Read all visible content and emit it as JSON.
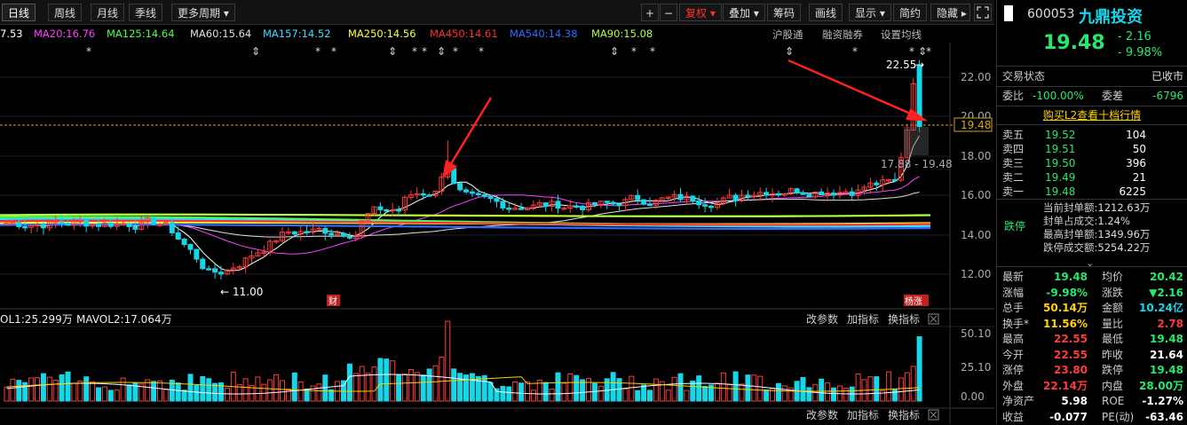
{
  "toolbar": {
    "tabs": [
      "日线",
      "周线",
      "月线",
      "季线",
      "更多周期 ▾"
    ],
    "right_buttons": [
      "+",
      "−",
      "复权 ▾",
      "叠加 ▾",
      "筹码",
      "画线",
      "显示 ▾",
      "简约",
      "隐藏 ▸"
    ],
    "expand_icon": "expand-icon"
  },
  "ma_legend": [
    {
      "text": "7.53",
      "color": "#ffffff"
    },
    {
      "text": "MA20:16.76",
      "color": "#ff40ff"
    },
    {
      "text": "MA125:14.64",
      "color": "#4cff4c"
    },
    {
      "text": "MA60:15.64",
      "color": "#e0e0e0"
    },
    {
      "text": "MA157:14.52",
      "color": "#33e0ff"
    },
    {
      "text": "MA250:14.56",
      "color": "#ffff40"
    },
    {
      "text": "MA450:14.61",
      "color": "#ff3030"
    },
    {
      "text": "MA540:14.38",
      "color": "#2f6bff"
    },
    {
      "text": "MA90:15.08",
      "color": "#b9ff3f"
    }
  ],
  "ma_links": [
    "沪股通",
    "融资融券",
    "设置均线"
  ],
  "price_axis": [
    "22.00",
    "20.00",
    "18.00",
    "16.00",
    "14.00",
    "12.00"
  ],
  "current_price_tag": "19.48",
  "annotations": {
    "high": "22.55",
    "low": "11.00",
    "range": "17.88 - 19.48",
    "badge_cai": "财",
    "badge_zt": "杨涨"
  },
  "volume_legend": {
    "vol1": "OL1:25.299万",
    "mavol2": "MAVOL2:17.064万",
    "buttons": [
      "改参数",
      "加指标",
      "换指标"
    ]
  },
  "volume_axis": [
    "50.10",
    "25.10",
    "0.00"
  ],
  "bottom_buttons": [
    "改参数",
    "加指标",
    "换指标"
  ],
  "stock": {
    "code": "600053",
    "name": "九鼎投资",
    "price": "19.48",
    "change": "- 2.16",
    "change_pct": "- 9.98%"
  },
  "status": {
    "label": "交易状态",
    "value": "已收市"
  },
  "weibi": {
    "label1": "委比",
    "value1": "-100.00%",
    "label2": "委差",
    "value2": "-6796"
  },
  "l2_link": "购买L2查看十档行情",
  "asks": [
    {
      "label": "卖五",
      "price": "19.52",
      "vol": "104"
    },
    {
      "label": "卖四",
      "price": "19.51",
      "vol": "50"
    },
    {
      "label": "卖三",
      "price": "19.50",
      "vol": "396"
    },
    {
      "label": "卖二",
      "price": "19.49",
      "vol": "21"
    },
    {
      "label": "卖一",
      "price": "19.48",
      "vol": "6225"
    }
  ],
  "limit_info": {
    "tag": "跌停",
    "lines": [
      {
        "label": "当前封单额:",
        "value": "1212.63万"
      },
      {
        "label": "封单占成交:",
        "value": "1.24%"
      },
      {
        "label": "最高封单额:",
        "value": "1349.96万"
      },
      {
        "label": "跌停成交额:",
        "value": "5254.22万"
      }
    ]
  },
  "quotes": [
    {
      "l1": "最新",
      "v1": "19.48",
      "c1": "green",
      "l2": "均价",
      "v2": "20.42",
      "c2": "green"
    },
    {
      "l1": "涨幅",
      "v1": "-9.98%",
      "c1": "green",
      "l2": "涨跌",
      "v2": "▼2.16",
      "c2": "green"
    },
    {
      "l1": "总手",
      "v1": "50.14万",
      "c1": "yellow",
      "l2": "金额",
      "v2": "10.24亿",
      "c2": "cyan"
    },
    {
      "l1": "换手*",
      "v1": "11.56%",
      "c1": "yellow",
      "l2": "量比",
      "v2": "2.78",
      "c2": "red"
    },
    {
      "l1": "最高",
      "v1": "22.55",
      "c1": "red",
      "l2": "最低",
      "v2": "19.48",
      "c2": "green"
    },
    {
      "l1": "今开",
      "v1": "22.55",
      "c1": "red",
      "l2": "昨收",
      "v2": "21.64",
      "c2": "white"
    },
    {
      "l1": "涨停",
      "v1": "23.80",
      "c1": "red",
      "l2": "跌停",
      "v2": "19.48",
      "c2": "green"
    },
    {
      "l1": "外盘",
      "v1": "22.14万",
      "c1": "red",
      "l2": "内盘",
      "v2": "28.00万",
      "c2": "green"
    },
    {
      "l1": "净资产",
      "v1": "5.98",
      "c1": "white",
      "l2": "ROE",
      "v2": "-1.27%",
      "c2": "white"
    },
    {
      "l1": "收益",
      "v1": "-0.077",
      "c1": "white",
      "l2": "PE(动)",
      "v2": "-63.46",
      "c2": "white"
    }
  ],
  "colors": {
    "up": "#ff3b3b",
    "down": "#16d7e8",
    "ma5": "#ffffff",
    "ma20": "#ff40ff"
  }
}
